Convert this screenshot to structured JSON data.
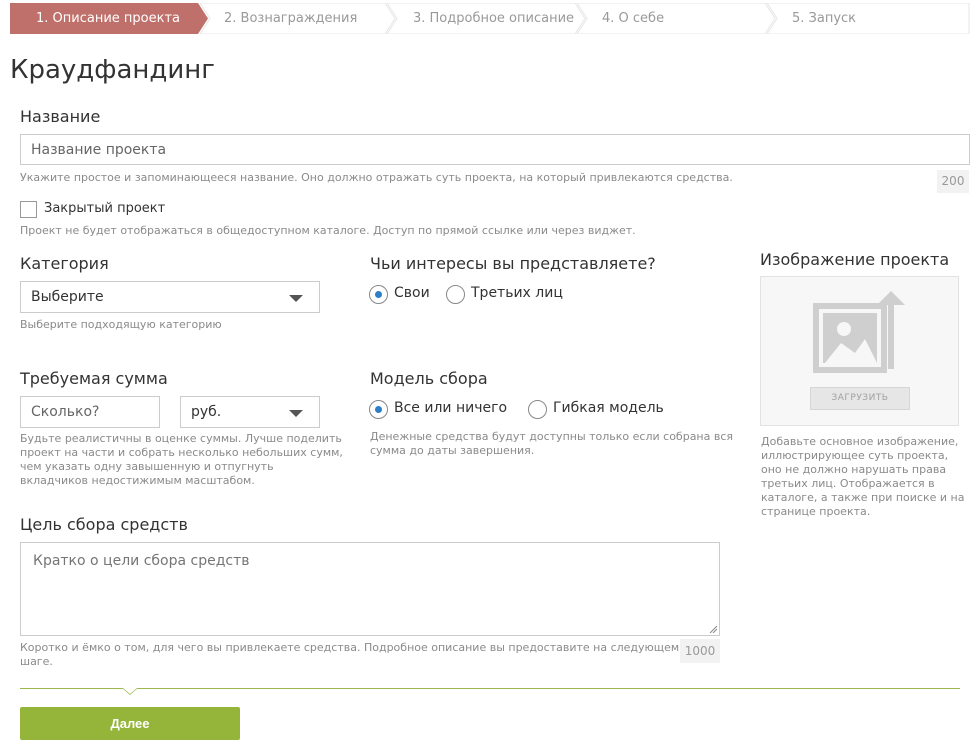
{
  "steps": [
    {
      "label": "1. Описание проекта",
      "active": true
    },
    {
      "label": "2. Вознаграждения",
      "active": false
    },
    {
      "label": "3. Подробное описание",
      "active": false
    },
    {
      "label": "4. О себе",
      "active": false
    },
    {
      "label": "5. Запуск",
      "active": false
    }
  ],
  "page": {
    "title": "Краудфандинг"
  },
  "name": {
    "label": "Название",
    "placeholder": "Название проекта",
    "hint": "Укажите простое и запоминающееся название. Оно должно отражать суть проекта, на который привлекаются средства.",
    "counter": "200"
  },
  "private": {
    "label": "Закрытый проект",
    "hint": "Проект не будет отображаться в общедоступном каталоге. Доступ по прямой ссылке или через виджет."
  },
  "category": {
    "label": "Категория",
    "selected": "Выберите",
    "hint": "Выберите подходящую категорию"
  },
  "interests": {
    "label": "Чьи интересы вы представляете?",
    "options": [
      "Свои",
      "Третьих лиц"
    ],
    "selected": "Свои"
  },
  "amount": {
    "label": "Требуемая сумма",
    "placeholder": "Сколько?",
    "currency": "руб.",
    "hint_lines": [
      "Будьте реалистичны в оценке суммы. Лучше поделить",
      "проект на части и собрать несколько небольших сумм,",
      "чем указать одну завышенную и отпугнуть",
      "вкладчиков недостижимым масштабом."
    ]
  },
  "model": {
    "label": "Модель сбора",
    "options": [
      "Все или ничего",
      "Гибкая модель"
    ],
    "selected": "Все или ничего",
    "hint_lines": [
      "Денежные средства будут доступны только если собрана вся",
      "сумма до даты завершения."
    ]
  },
  "image": {
    "label": "Изображение проекта",
    "upload_label": "ЗАГРУЗИТЬ",
    "hint_lines": [
      "Добавьте основное изображение,",
      "иллюстрирующее суть проекта,",
      "оно не должно нарушать права",
      "третьих лиц. Отображается в",
      "каталоге, а также при поиске и на",
      "странице проекта."
    ]
  },
  "goal": {
    "label": "Цель сбора средств",
    "placeholder": "Кратко о цели сбора средств",
    "hint_lines": [
      "Коротко и ёмко о том, для чего вы привлекаете средства. Подробное описание вы предоставите на следующем",
      "шаге."
    ],
    "counter": "1000"
  },
  "next": {
    "label": "Далее"
  },
  "colors": {
    "active_step": "#c0706a",
    "accent": "#94b43a",
    "radio": "#2d7fc7"
  }
}
